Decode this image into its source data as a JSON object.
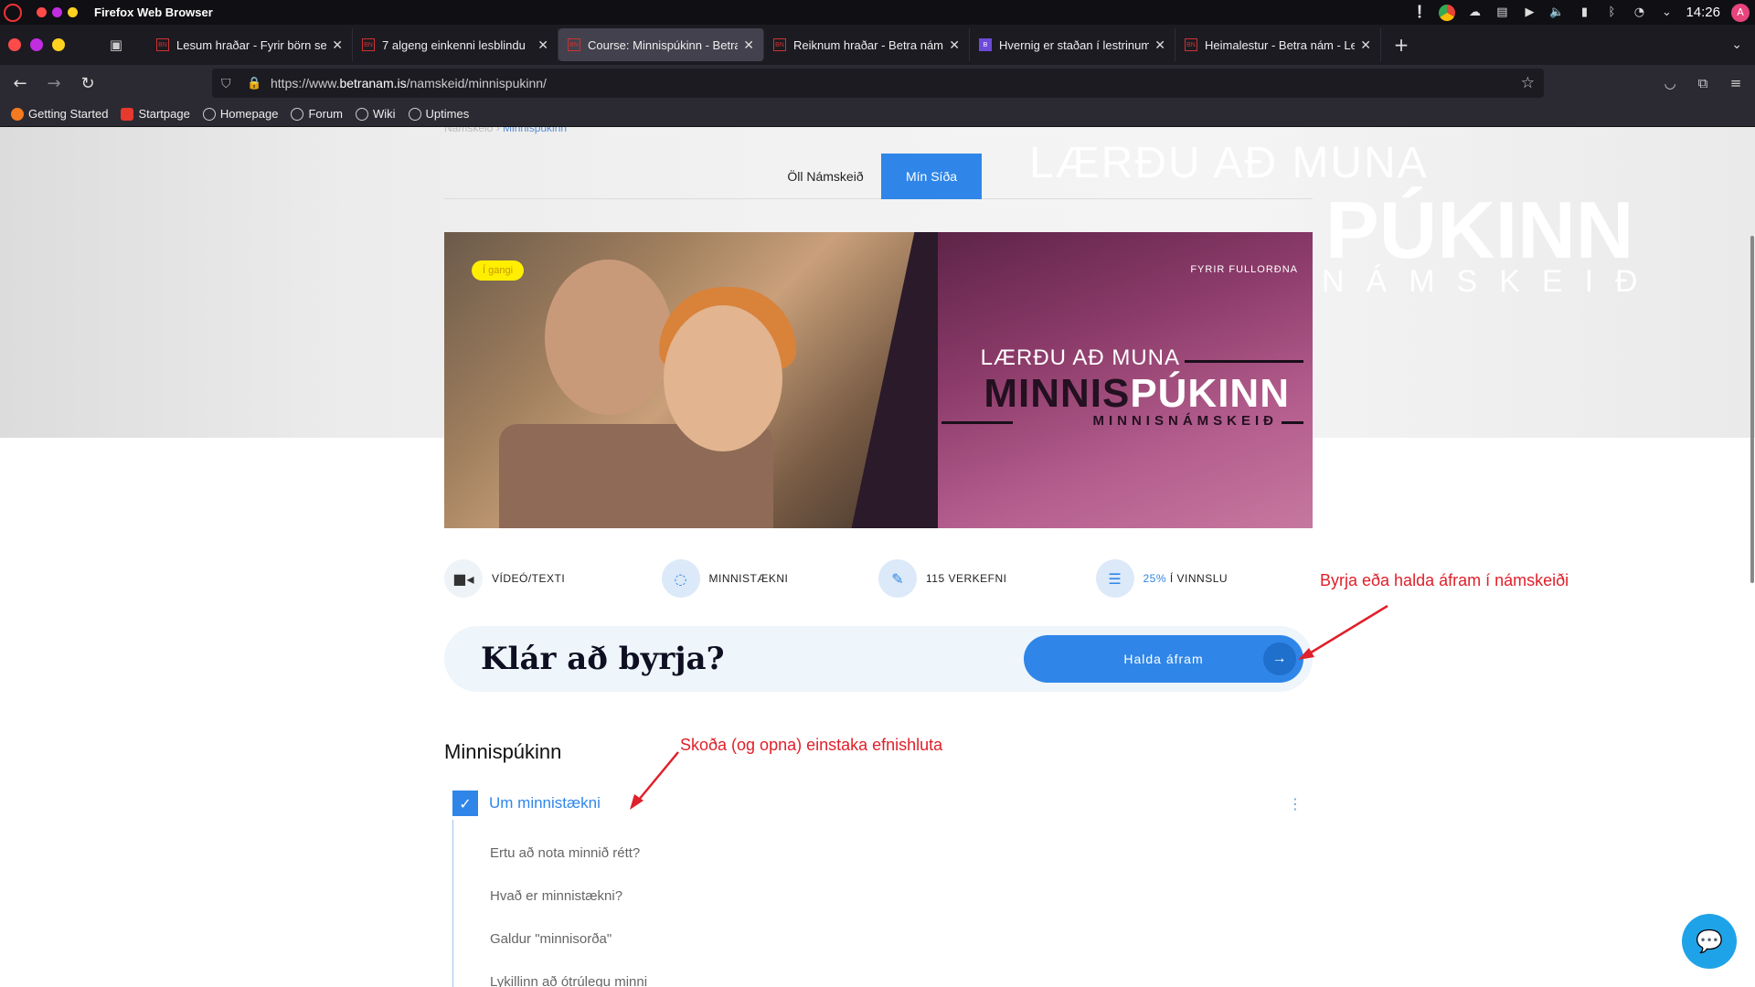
{
  "os": {
    "app_title": "Firefox Web Browser",
    "clock": "14:26",
    "avatar_letter": "A"
  },
  "tabs": [
    {
      "label": "Lesum hraðar - Fyrir börn sem",
      "fav": "BN"
    },
    {
      "label": "7 algeng einkenni lesblindu",
      "fav": "BN"
    },
    {
      "label": "Course: Minnispúkinn - Betra",
      "fav": "BN"
    },
    {
      "label": "Reiknum hraðar - Betra nám",
      "fav": "BN"
    },
    {
      "label": "Hvernig er staðan í lestrinum",
      "fav": "B"
    },
    {
      "label": "Heimalestur - Betra nám - Le",
      "fav": "BN"
    }
  ],
  "nav": {
    "url_prefix": "https://www.",
    "url_host": "betranam.is",
    "url_path": "/namskeid/minnispukinn/"
  },
  "bookmarks": [
    "Getting Started",
    "Startpage",
    "Homepage",
    "Forum",
    "Wiki",
    "Uptimes"
  ],
  "page": {
    "breadcrumb_parent": "Námskeið",
    "breadcrumb_sep": " › ",
    "breadcrumb_current": "Minnispúkinn",
    "ghost_line1": "LÆRÐU AÐ MUNA",
    "ghost_line2": "PÚKINN",
    "ghost_line3": "NÁMSKEIÐ",
    "tab_all": "Öll Námskeið",
    "tab_mine": "Mín Síða",
    "banner": {
      "status_badge": "Í gangi",
      "kicker": "FYRIR FULLORÐNA",
      "line1": "LÆRÐU AÐ MUNA",
      "line2a": "MINNIS",
      "line2b": "PÚKINN",
      "line3": "MINNISNÁMSKEIÐ"
    },
    "features": {
      "video": "VÍDEÓ/TEXTI",
      "technique": "MINNISTÆKNI",
      "tasks": "115 VERKEFNI",
      "progress_pct": "25%",
      "progress_label": " Í VINNSLU"
    },
    "ready_title": "Klár að byrja?",
    "continue_label": "Halda áfram",
    "section_title": "Minnispúkinn",
    "lesson_title": "Um minnistækni",
    "sub_lessons": [
      "Ertu að nota minnið rétt?",
      "Hvað er minnistækni?",
      "Galdur \"minnisorða\"",
      "Lykillinn að ótrúlegu minni"
    ]
  },
  "annotations": {
    "continue_note": "Byrja eða halda áfram í námskeiði",
    "lessons_note": "Skoða (og opna) einstaka efnishluta"
  },
  "colors": {
    "accent": "#2f86e8",
    "annotation": "#e0202a",
    "badge": "#ffee00"
  },
  "progress_fraction": 0.25
}
